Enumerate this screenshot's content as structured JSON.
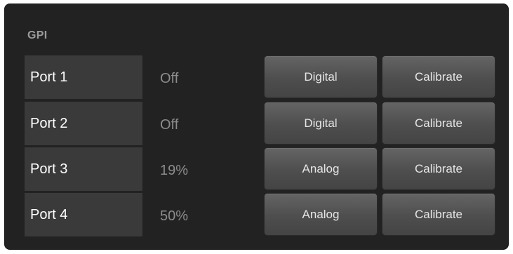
{
  "panel": {
    "title": "GPI"
  },
  "ports": [
    {
      "name": "Port 1",
      "status": "Off",
      "mode_label": "Digital",
      "calibrate_label": "Calibrate"
    },
    {
      "name": "Port 2",
      "status": "Off",
      "mode_label": "Digital",
      "calibrate_label": "Calibrate"
    },
    {
      "name": "Port 3",
      "status": "19%",
      "mode_label": "Analog",
      "calibrate_label": "Calibrate"
    },
    {
      "name": "Port 4",
      "status": "50%",
      "mode_label": "Analog",
      "calibrate_label": "Calibrate"
    }
  ],
  "colors": {
    "panel_bg": "#222222",
    "port_bg": "#3a3a3a",
    "button_top": "#646464",
    "button_bottom": "#444444",
    "title": "#9a9a9a",
    "status": "#8c8c8c"
  }
}
